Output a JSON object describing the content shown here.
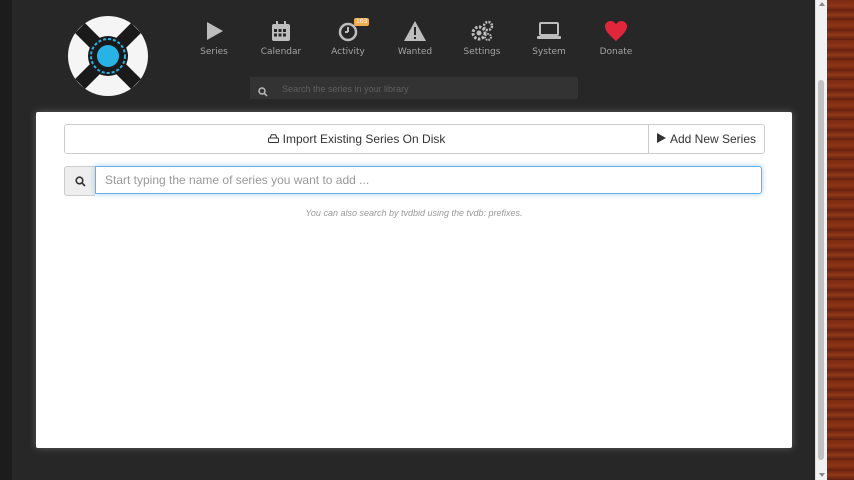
{
  "nav": {
    "items": [
      {
        "label": "Series",
        "icon": "play-icon"
      },
      {
        "label": "Calendar",
        "icon": "calendar-icon"
      },
      {
        "label": "Activity",
        "icon": "clock-icon",
        "badge": "103"
      },
      {
        "label": "Wanted",
        "icon": "warning-icon"
      },
      {
        "label": "Settings",
        "icon": "gears-icon"
      },
      {
        "label": "System",
        "icon": "laptop-icon"
      },
      {
        "label": "Donate",
        "icon": "heart-icon"
      }
    ]
  },
  "library_search": {
    "placeholder": "Search the series in your library"
  },
  "panel": {
    "import_label": "Import Existing Series On Disk",
    "add_label": "Add New Series",
    "search_placeholder": "Start typing the name of series you want to add ...",
    "hint": "You can also search by tvdbid using the tvdb: prefixes."
  },
  "colors": {
    "heart": "#e0263a",
    "badge": "#f0ad4e",
    "focus": "#66afe9",
    "logo_accent": "#27b3e6"
  }
}
